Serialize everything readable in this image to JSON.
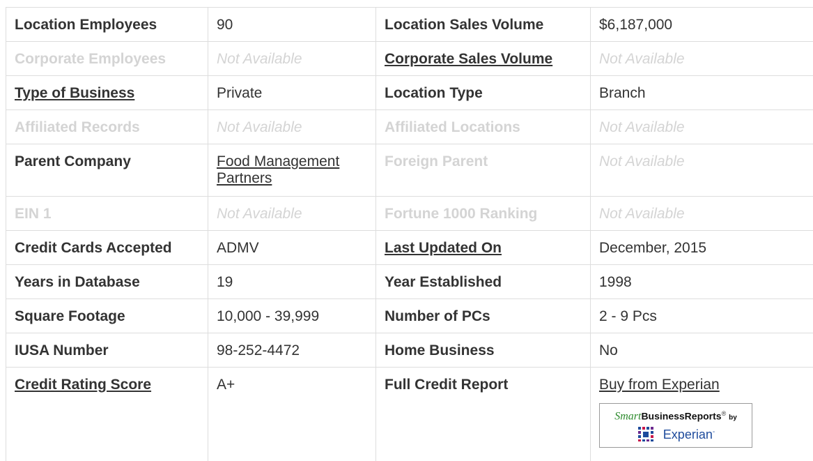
{
  "rows": [
    {
      "l1": "Location Employees",
      "v1": "90",
      "l2": "Location Sales Volume",
      "v2": "$6,187,000"
    },
    {
      "l1": "Corporate Employees",
      "v1": "Not Available",
      "l2": "Corporate Sales Volume",
      "v2": "Not Available"
    },
    {
      "l1": "Type of Business",
      "v1": "Private",
      "l2": "Location Type",
      "v2": "Branch"
    },
    {
      "l1": "Affiliated Records",
      "v1": "Not Available",
      "l2": "Affiliated Locations",
      "v2": "Not Available"
    },
    {
      "l1": "Parent Company",
      "v1": "Food Management Partners",
      "l2": "Foreign Parent",
      "v2": "Not Available"
    },
    {
      "l1": "EIN 1",
      "v1": "Not Available",
      "l2": "Fortune 1000 Ranking",
      "v2": "Not Available"
    },
    {
      "l1": "Credit Cards Accepted",
      "v1": "ADMV",
      "l2": "Last Updated On",
      "v2": "December, 2015"
    },
    {
      "l1": "Years in Database",
      "v1": "19",
      "l2": "Year Established",
      "v2": "1998"
    },
    {
      "l1": "Square Footage",
      "v1": "10,000 - 39,999",
      "l2": "Number of PCs",
      "v2": "2 - 9 Pcs"
    },
    {
      "l1": "IUSA Number",
      "v1": "98-252-4472",
      "l2": "Home Business",
      "v2": "No"
    },
    {
      "l1": "Credit Rating Score",
      "v1": "A+",
      "l2": "Full Credit Report",
      "v2": "Buy from Experian"
    }
  ],
  "badge": {
    "smart": "Smart",
    "business_reports": "BusinessReports",
    "reg": "®",
    "by": "by",
    "experian": "Experian",
    "tm": "-"
  },
  "colors": {
    "text": "#333333",
    "disabled": "#d4d4d4",
    "border": "#dddddd",
    "experian_blue": "#1e4b9c",
    "smart_green": "#2e8b2e"
  }
}
